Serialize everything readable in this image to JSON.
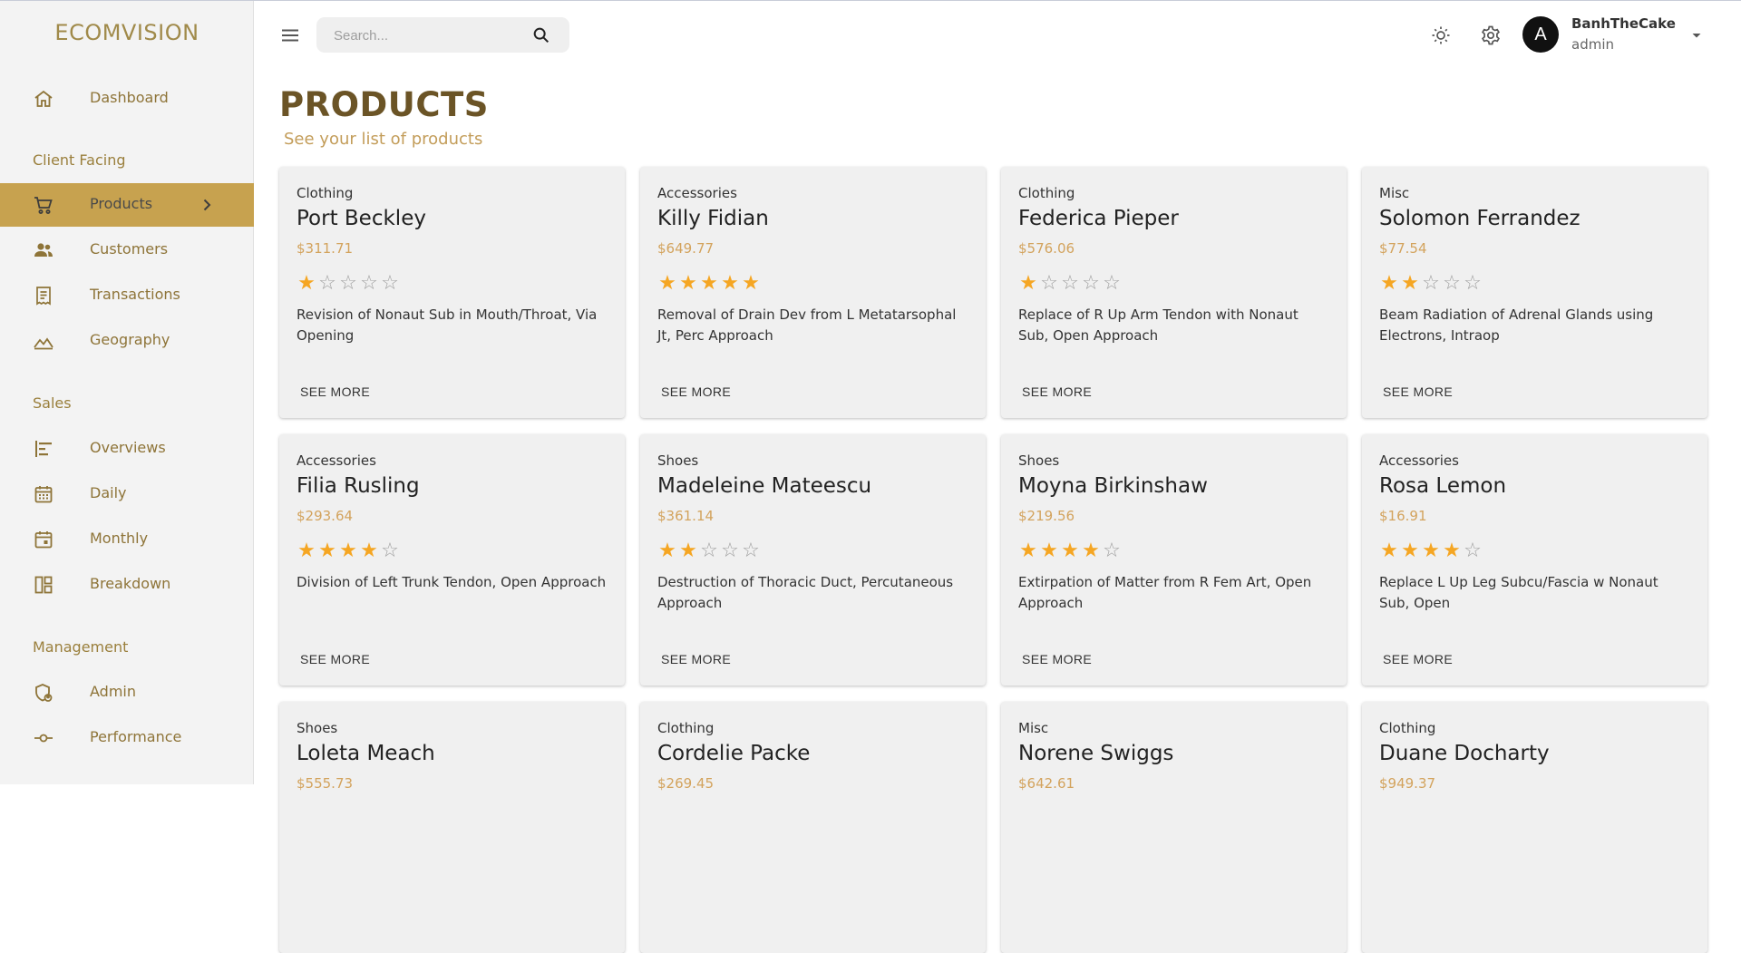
{
  "app": {
    "brand": "ECOMVISION"
  },
  "sidebar": {
    "sections": {
      "client_facing": "Client Facing",
      "sales": "Sales",
      "management": "Management"
    },
    "items": [
      {
        "label": "Dashboard",
        "icon": "home-icon"
      },
      {
        "label": "Products",
        "icon": "shopping-cart-icon",
        "active": true
      },
      {
        "label": "Customers",
        "icon": "groups-icon"
      },
      {
        "label": "Transactions",
        "icon": "receipt-icon"
      },
      {
        "label": "Geography",
        "icon": "mountain-chart-icon"
      },
      {
        "label": "Overviews",
        "icon": "bar-chart-icon"
      },
      {
        "label": "Daily",
        "icon": "calendar-icon"
      },
      {
        "label": "Monthly",
        "icon": "calendar-month-icon"
      },
      {
        "label": "Breakdown",
        "icon": "layout-icon"
      },
      {
        "label": "Admin",
        "icon": "admin-shield-icon"
      },
      {
        "label": "Performance",
        "icon": "commit-icon"
      }
    ]
  },
  "topbar": {
    "search_placeholder": "Search...",
    "user": {
      "initial": "A",
      "name": "BanhTheCake",
      "role": "admin"
    }
  },
  "header": {
    "title": "PRODUCTS",
    "subtitle": "See your list of products"
  },
  "products": [
    {
      "category": "Clothing",
      "name": "Port Beckley",
      "price": "$311.71",
      "rating": 1,
      "description": "Revision of Nonaut Sub in Mouth/Throat, Via Opening",
      "action": "SEE MORE"
    },
    {
      "category": "Accessories",
      "name": "Killy Fidian",
      "price": "$649.77",
      "rating": 5,
      "description": "Removal of Drain Dev from L Metatarsophal Jt, Perc Approach",
      "action": "SEE MORE"
    },
    {
      "category": "Clothing",
      "name": "Federica Pieper",
      "price": "$576.06",
      "rating": 1,
      "description": "Replace of R Up Arm Tendon with Nonaut Sub, Open Approach",
      "action": "SEE MORE"
    },
    {
      "category": "Misc",
      "name": "Solomon Ferrandez",
      "price": "$77.54",
      "rating": 2,
      "description": "Beam Radiation of Adrenal Glands using Electrons, Intraop",
      "action": "SEE MORE"
    },
    {
      "category": "Accessories",
      "name": "Filia Rusling",
      "price": "$293.64",
      "rating": 4,
      "description": "Division of Left Trunk Tendon, Open Approach",
      "action": "SEE MORE"
    },
    {
      "category": "Shoes",
      "name": "Madeleine Mateescu",
      "price": "$361.14",
      "rating": 2,
      "description": "Destruction of Thoracic Duct, Percutaneous Approach",
      "action": "SEE MORE"
    },
    {
      "category": "Shoes",
      "name": "Moyna Birkinshaw",
      "price": "$219.56",
      "rating": 4,
      "description": "Extirpation of Matter from R Fem Art, Open Approach",
      "action": "SEE MORE"
    },
    {
      "category": "Accessories",
      "name": "Rosa Lemon",
      "price": "$16.91",
      "rating": 4,
      "description": "Replace L Up Leg Subcu/Fascia w Nonaut Sub, Open",
      "action": "SEE MORE"
    },
    {
      "category": "Shoes",
      "name": "Loleta Meach",
      "price": "$555.73",
      "rating": 0,
      "description": "",
      "action": ""
    },
    {
      "category": "Clothing",
      "name": "Cordelie Packe",
      "price": "$269.45",
      "rating": 0,
      "description": "",
      "action": ""
    },
    {
      "category": "Misc",
      "name": "Norene Swiggs",
      "price": "$642.61",
      "rating": 0,
      "description": "",
      "action": ""
    },
    {
      "category": "Clothing",
      "name": "Duane Docharty",
      "price": "$949.37",
      "rating": 0,
      "description": "",
      "action": ""
    }
  ]
}
